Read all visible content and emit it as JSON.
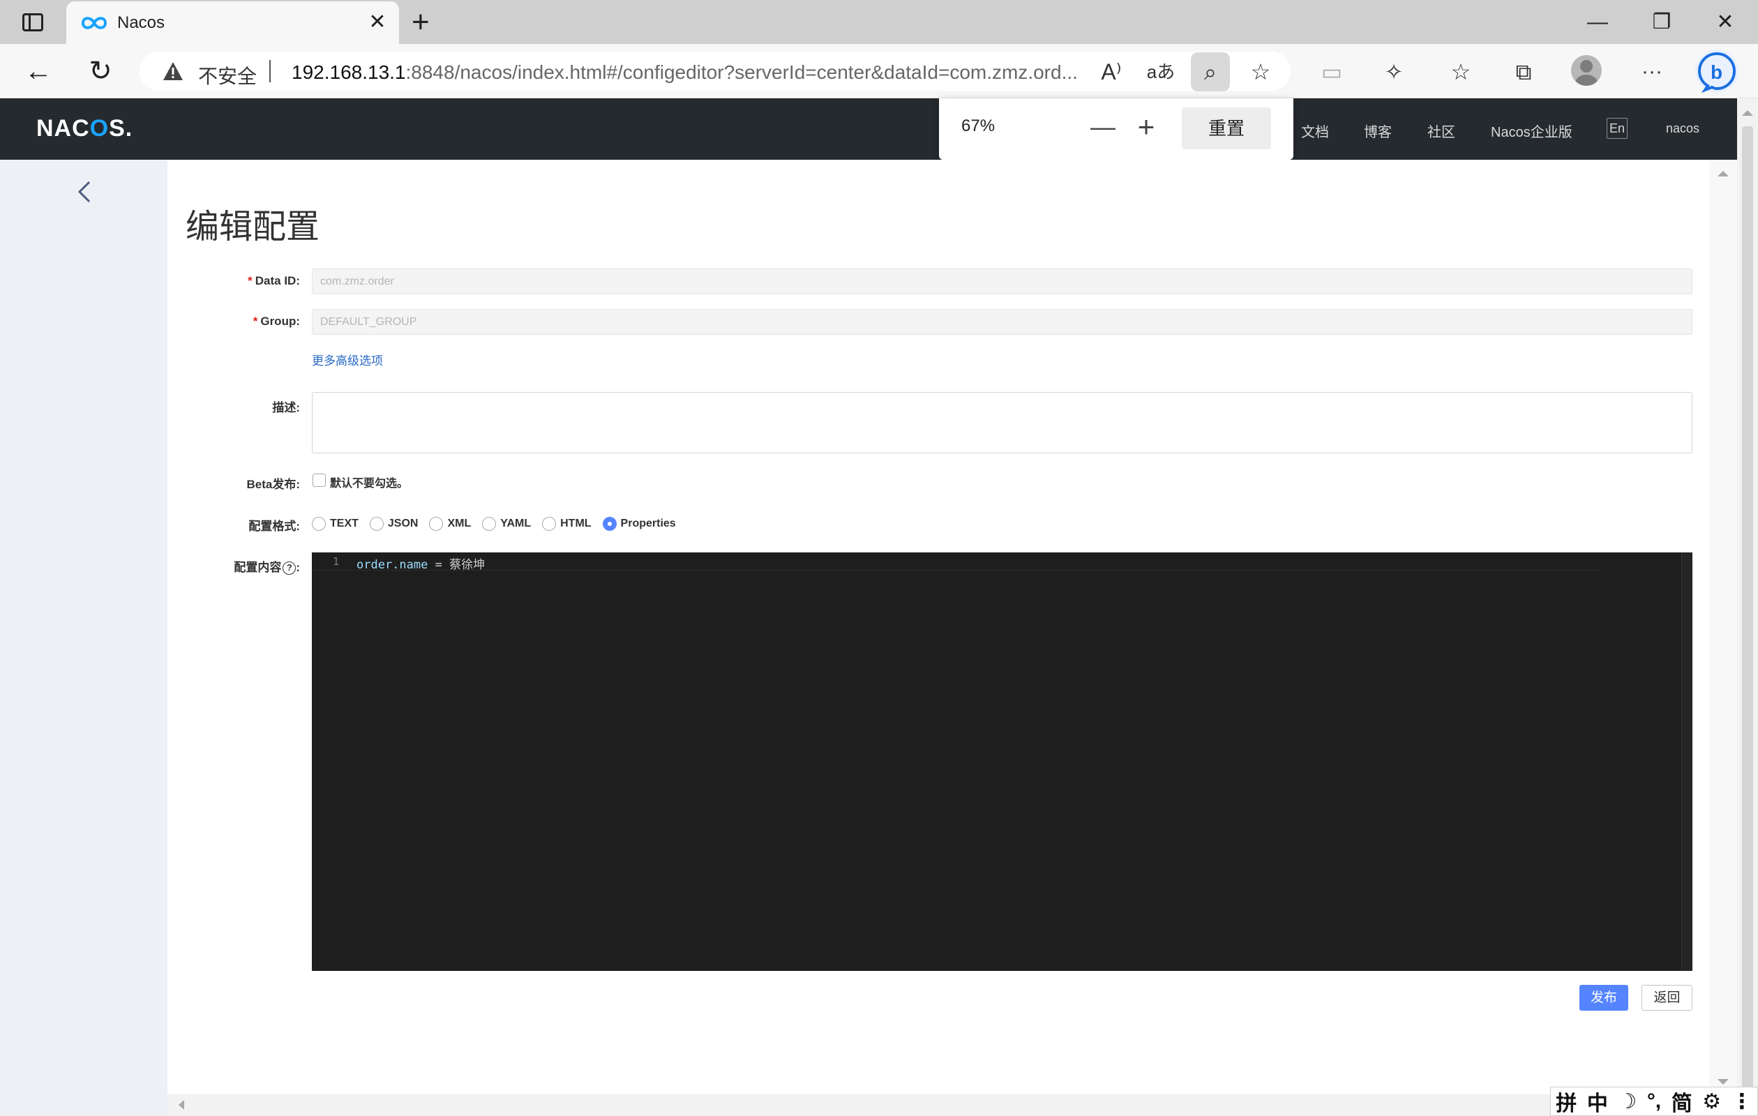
{
  "browser": {
    "tab": {
      "title": "Nacos",
      "close": "✕"
    },
    "new_tab": "+",
    "window": {
      "minimize": "—",
      "restore": "❐",
      "close": "✕"
    },
    "nav": {
      "back": "←",
      "refresh": "↻"
    },
    "address": {
      "security_label": "不安全",
      "url_host": "192.168.13.1",
      "url_rest": ":8848/nacos/index.html#/configeditor?serverId=center&dataId=com.zmz.ord..."
    },
    "icons": {
      "read_aloud": "A⁾",
      "translate": "aあ",
      "zoom": "⌕",
      "favorite_add": "☆",
      "split": "▭",
      "extensions": "✧",
      "favorites": "☆",
      "collections": "⧉",
      "more": "···",
      "bing": "b"
    }
  },
  "zoom_popup": {
    "value": "67%",
    "minus": "—",
    "plus": "+",
    "reset": "重置"
  },
  "header": {
    "logo_left": "NAC",
    "logo_accent": "O",
    "logo_right": "S.",
    "nav": [
      "文档",
      "博客",
      "社区",
      "Nacos企业版"
    ],
    "lang": "En",
    "user": "nacos"
  },
  "page": {
    "title": "编辑配置",
    "fields": {
      "data_id": {
        "label": "Data ID:",
        "value": "com.zmz.order"
      },
      "group": {
        "label": "Group:",
        "value": "DEFAULT_GROUP"
      },
      "advanced_link": "更多高级选项",
      "description": {
        "label": "描述:"
      },
      "beta": {
        "label": "Beta发布:",
        "checkbox_label": "默认不要勾选。"
      },
      "format": {
        "label": "配置格式:",
        "options": [
          "TEXT",
          "JSON",
          "XML",
          "YAML",
          "HTML",
          "Properties"
        ],
        "selected": "Properties"
      },
      "content": {
        "label": "配置内容",
        "help": "?",
        "line_number": "1",
        "code_key": "order.name",
        "code_op": " = ",
        "code_value": "蔡徐坤"
      }
    },
    "buttons": {
      "publish": "发布",
      "back": "返回"
    }
  },
  "ime": {
    "items": [
      "拼",
      "中",
      "☽",
      "°,",
      "简",
      "⚙",
      "⋮"
    ]
  }
}
